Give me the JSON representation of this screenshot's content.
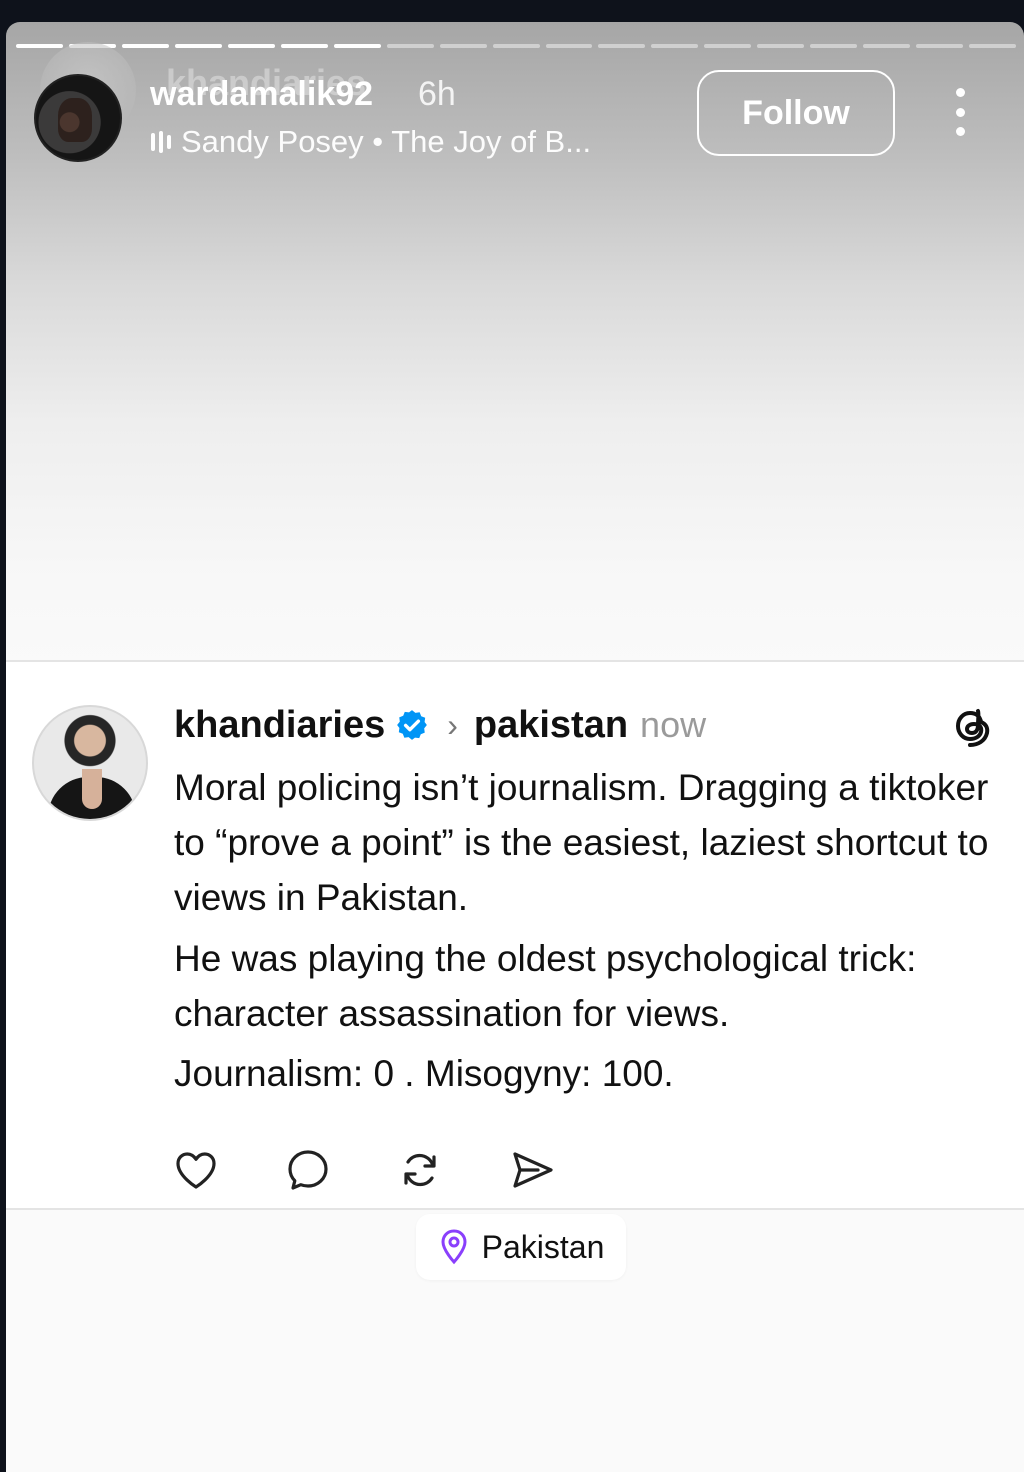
{
  "story": {
    "progress": {
      "total_segments": 19,
      "completed_segments": 7
    },
    "ghost_username": "khandiaries",
    "username": "wardamalik92",
    "time": "6h",
    "music_label": "Sandy Posey • The Joy of B...",
    "follow_label": "Follow"
  },
  "post": {
    "username": "khandiaries",
    "topic": "pakistan",
    "time": "now",
    "paragraphs": [
      "Moral policing isn’t journalism. Dragging a tiktoker to “prove a point” is the easiest, laziest shortcut to views in Pakistan.",
      "He was playing the oldest psychological trick: character assassination for views.",
      "Journalism: 0 . Misogyny: 100."
    ]
  },
  "location": {
    "label": "Pakistan"
  },
  "icons": {
    "verified": "verified-badge-icon",
    "threads": "threads-logo-icon",
    "like": "heart-icon",
    "comment": "comment-icon",
    "repost": "repost-icon",
    "share": "send-icon",
    "location": "location-pin-icon",
    "more": "more-vertical-icon"
  },
  "colors": {
    "verified_blue": "#0095f6",
    "location_pin": "#8a3ffc"
  }
}
